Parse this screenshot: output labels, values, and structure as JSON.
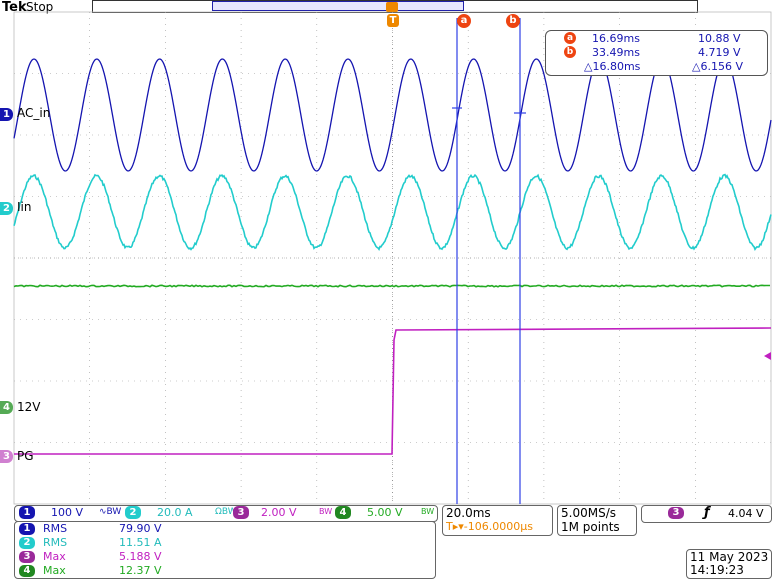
{
  "header": {
    "brand": "Tek",
    "status": "Stop"
  },
  "markers": {
    "trigger": "T",
    "cursor_a": "a",
    "cursor_b": "b"
  },
  "cursor_readout": {
    "a_time": "16.69ms",
    "a_value": "10.88 V",
    "b_time": "33.49ms",
    "b_value": "4.719 V",
    "delta_time": "△16.80ms",
    "delta_value": "△6.156 V"
  },
  "channels": [
    {
      "num": "1",
      "label": "AC_in",
      "color": "#1515b0"
    },
    {
      "num": "2",
      "label": "Iin",
      "color": "#22cccc"
    },
    {
      "num": "3",
      "label": "PG",
      "color": "#c020c0"
    },
    {
      "num": "4",
      "label": "12V",
      "color": "#22aa22"
    }
  ],
  "bottom_bar": {
    "ch1_scale": "100 V",
    "ch1_coupling": "∿BW",
    "ch2_scale": "20.0 A",
    "ch2_coupling": "ΩBW",
    "ch3_scale": "2.00 V",
    "ch3_coupling": "BW",
    "ch4_scale": "5.00 V",
    "ch4_coupling": "BW"
  },
  "timebase": {
    "scale": "20.0ms",
    "trigger_pos": "T▸▾-106.0000µs",
    "sample_rate": "5.00MS/s",
    "record_length": "1M points"
  },
  "trigger": {
    "source": "3",
    "slope": "ƒ",
    "level": "4.04 V"
  },
  "measurements": [
    {
      "num": "1",
      "name": "RMS",
      "value": "79.90 V"
    },
    {
      "num": "2",
      "name": "RMS",
      "value": "11.51 A"
    },
    {
      "num": "3",
      "name": "Max",
      "value": "5.188 V"
    },
    {
      "num": "4",
      "name": "Max",
      "value": "12.37 V"
    }
  ],
  "datetime": {
    "date": "11 May 2023",
    "time": "14:19:23"
  }
}
